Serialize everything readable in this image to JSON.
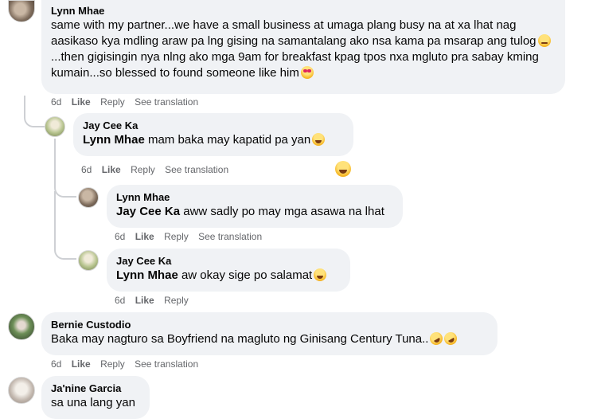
{
  "comments": [
    {
      "author": "Lynn Mhae",
      "text_a": "same with my partner...we have a small business at umaga plang busy na at xa lhat nag aasikaso kya mdling araw pa lng gising na samantalang ako nsa kama pa msarap ang tulog",
      "text_b": "...then gigisingin nya nlng ako mga 9am for breakfast kpag tpos nxa mgluto pra sabay kming kumain...so blessed to found someone like him",
      "time": "6d",
      "like": "Like",
      "reply": "Reply",
      "translation": "See translation"
    },
    {
      "author": "Jay Cee Ka",
      "mention": "Lynn Mhae",
      "text": "mam baka may kapatid pa yan",
      "time": "6d",
      "like": "Like",
      "reply": "Reply",
      "translation": "See translation",
      "reaction_icon": "laughing-face-icon"
    },
    {
      "author": "Lynn Mhae",
      "mention": "Jay Cee Ka",
      "text": "aww sadly po may mga asawa na lhat",
      "time": "6d",
      "like": "Like",
      "reply": "Reply",
      "translation": "See translation"
    },
    {
      "author": "Jay Cee Ka",
      "mention": "Lynn Mhae",
      "text": "aw okay sige po salamat",
      "time": "6d",
      "like": "Like",
      "reply": "Reply"
    },
    {
      "author": "Bernie Custodio",
      "text": "Baka may nagturo sa Boyfriend na magluto ng Ginisang Century Tuna..",
      "time": "6d",
      "like": "Like",
      "reply": "Reply",
      "translation": "See translation"
    },
    {
      "author": "Ja'nine Garcia",
      "text": "sa una lang yan"
    }
  ]
}
